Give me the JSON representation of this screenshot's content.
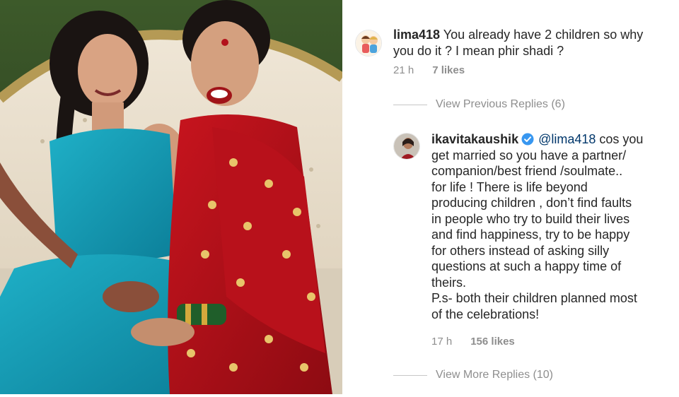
{
  "comments": [
    {
      "username": "lima418",
      "text_lines": [
        " You already have 2 children so why",
        "you do it ? I mean phir shadi ?"
      ],
      "time": "21 h",
      "likes": "7 likes",
      "avatar_icon": "cartoon-kids-avatar"
    },
    {
      "username": "ikavitakaushik",
      "verified_icon": "verified-badge-icon",
      "mention": "@lima418",
      "text_first": " cos you",
      "text_lines": [
        "get married so you have a partner/",
        "companion/best friend /soulmate..",
        "for life ! There is life beyond",
        "producing children , don’t find faults",
        "in people who try to build their lives",
        "and find happiness, try to be happy",
        "for others instead of asking silly",
        "questions at such a happy time of",
        "theirs.",
        "P.s- both their children planned most",
        "of the celebrations!"
      ],
      "time": "17 h",
      "likes": "156 likes",
      "avatar_icon": "profile-photo-avatar"
    }
  ],
  "view_previous_replies": "View Previous Replies (6)",
  "view_more_replies": "View More Replies (10)",
  "colors": {
    "text": "#262626",
    "muted": "#8e8e8e",
    "mention": "#00376b",
    "verified": "#3897f0"
  }
}
